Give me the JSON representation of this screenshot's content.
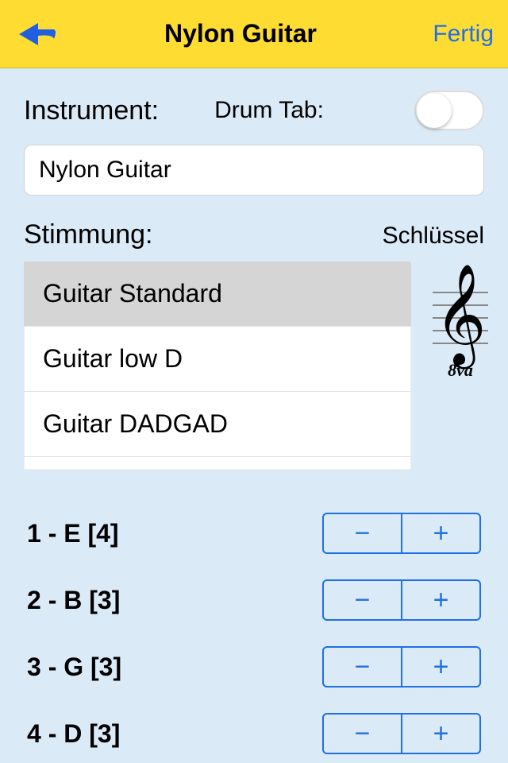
{
  "header": {
    "title": "Nylon Guitar",
    "done": "Fertig"
  },
  "labels": {
    "instrument": "Instrument:",
    "drum_tab": "Drum Tab:",
    "tuning": "Stimmung:",
    "clef": "Schlüssel"
  },
  "instrument_value": "Nylon Guitar",
  "drum_tab_on": false,
  "tunings": [
    {
      "label": "Guitar Standard",
      "selected": true
    },
    {
      "label": "Guitar low D",
      "selected": false
    },
    {
      "label": "Guitar DADGAD",
      "selected": false
    }
  ],
  "clef": {
    "octave_marker": "8va"
  },
  "strings": [
    {
      "label": "1 - E [4]"
    },
    {
      "label": "2 - B [3]"
    },
    {
      "label": "3 - G [3]"
    },
    {
      "label": "4 - D [3]"
    }
  ],
  "stepper": {
    "minus": "−",
    "plus": "+"
  }
}
